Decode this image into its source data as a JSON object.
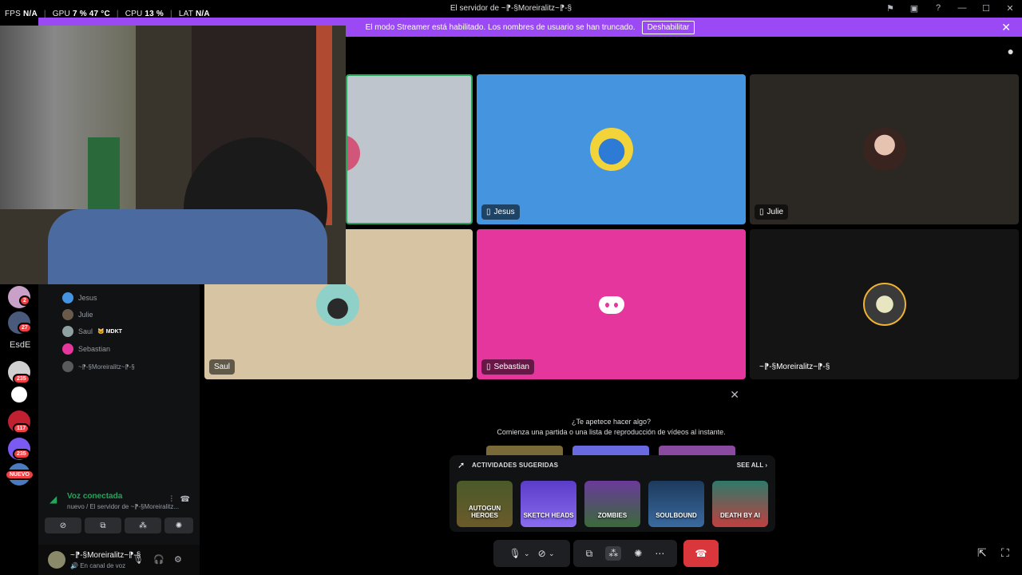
{
  "overlay": {
    "fps_label": "FPS",
    "fps_value": "N/A",
    "gpu_label": "GPU",
    "gpu_value": "7 %",
    "gpu_temp": "47 °C",
    "cpu_label": "CPU",
    "cpu_value": "13 %",
    "lat_label": "LAT",
    "lat_value": "N/A"
  },
  "window": {
    "title": "El servidor de ~⁋-§Moreiralitz~⁋-§"
  },
  "banner": {
    "text": "El modo Streamer está habilitado. Los nombres de usuario se han truncado.",
    "button": "Deshabilitar",
    "close": "✕",
    "color": "#9b48f5"
  },
  "rail": {
    "badges": [
      "2",
      "27",
      "235",
      "117",
      "235"
    ],
    "text_item": "EsdE",
    "new_label": "NUEVO"
  },
  "sidebar": {
    "members": [
      {
        "name": "Jesus"
      },
      {
        "name": "Julie"
      },
      {
        "name": "Saul",
        "tag": "MDKT"
      },
      {
        "name": "Sebastian"
      },
      {
        "name": "~⁋-§Moreiralitz~⁋-§"
      }
    ],
    "voice": {
      "status": "Voz conectada",
      "channel": "nuevo / El servidor de ~⁋-§Moreiralitz..."
    },
    "user": {
      "name": "~⁋-§Moreiralitz~⁋-§",
      "status": "En canal de voz"
    }
  },
  "tiles": {
    "jesus": {
      "name": "Jesus",
      "color": "#4594e0"
    },
    "julie": {
      "name": "Julie",
      "color": "#2b2723"
    },
    "saul": {
      "name": "Saul",
      "color": "#d6c4a3"
    },
    "sebastian": {
      "name": "Sebastian",
      "color": "#e5369e"
    },
    "moreiralitz": {
      "name": "~⁋-§Moreiralitz~⁋-§",
      "color": "#141414"
    }
  },
  "activity": {
    "question": "¿Te apetece hacer algo?",
    "subtitle": "Comienza una partida o una lista de reproducción de vídeos al instante.",
    "suggested_title": "ACTIVIDADES SUGERIDAS",
    "see_all": "SEE ALL",
    "games": [
      {
        "name": "AUTOGUN HEROES",
        "color": "#6b5a2a"
      },
      {
        "name": "SKETCH HEADS",
        "color": "#6a4cd8"
      },
      {
        "name": "ZOMBIES",
        "color": "#4e3a7a"
      },
      {
        "name": "SOULBOUND",
        "color": "#1d3a5c"
      },
      {
        "name": "DEATH BY AI",
        "color": "#2e7a6a"
      }
    ]
  },
  "controls": {
    "disconnect_color": "#da373c"
  }
}
